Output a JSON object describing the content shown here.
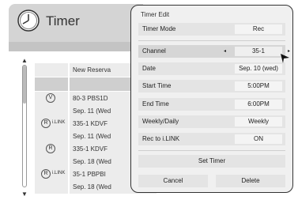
{
  "background": {
    "title": "Timer",
    "rows": [
      {
        "badge": "",
        "ilink": "",
        "text": "New Reserva",
        "style": "light"
      },
      {
        "badge": "",
        "ilink": "",
        "text": "",
        "style": "gray"
      },
      {
        "badge": "V",
        "ilink": "",
        "text": "80-3  PBS1D",
        "style": "light"
      },
      {
        "badge": "",
        "ilink": "",
        "text": "Sep. 11 (Wed",
        "style": "light"
      },
      {
        "badge": "R",
        "ilink": "i.LINK",
        "text": "335-1  KDVF",
        "style": "light"
      },
      {
        "badge": "",
        "ilink": "",
        "text": "Sep. 11 (Wed",
        "style": "light"
      },
      {
        "badge": "R",
        "ilink": "",
        "text": "335-1  KDVF",
        "style": "light"
      },
      {
        "badge": "",
        "ilink": "",
        "text": "Sep. 18 (Wed",
        "style": "light"
      },
      {
        "badge": "R",
        "ilink": "i.LINK",
        "text": "35-1  PBPBI",
        "style": "light"
      },
      {
        "badge": "",
        "ilink": "",
        "text": "Sep. 18 (Wed",
        "style": "light"
      }
    ]
  },
  "dialog": {
    "title": "Timer Edit",
    "fields": {
      "timer_mode": {
        "label": "Timer Mode",
        "value": "Rec"
      },
      "channel": {
        "label": "Channel",
        "value": "35-1"
      },
      "date": {
        "label": "Date",
        "value": "Sep. 10 (wed)"
      },
      "start_time": {
        "label": "Start Time",
        "value": "5:00PM"
      },
      "end_time": {
        "label": "End Time",
        "value": "6:00PM"
      },
      "weekly_daily": {
        "label": "Weekly/Daily",
        "value": "Weekly"
      },
      "rec_to_ilink": {
        "label": "Rec to i.LINK",
        "value": "ON"
      }
    },
    "set_timer_label": "Set Timer",
    "cancel_label": "Cancel",
    "delete_label": "Delete"
  },
  "icons": {
    "clock": "clock-icon",
    "arrow_left": "◂",
    "arrow_right": "▸",
    "scroll_up": "▲",
    "scroll_down": "▼"
  }
}
